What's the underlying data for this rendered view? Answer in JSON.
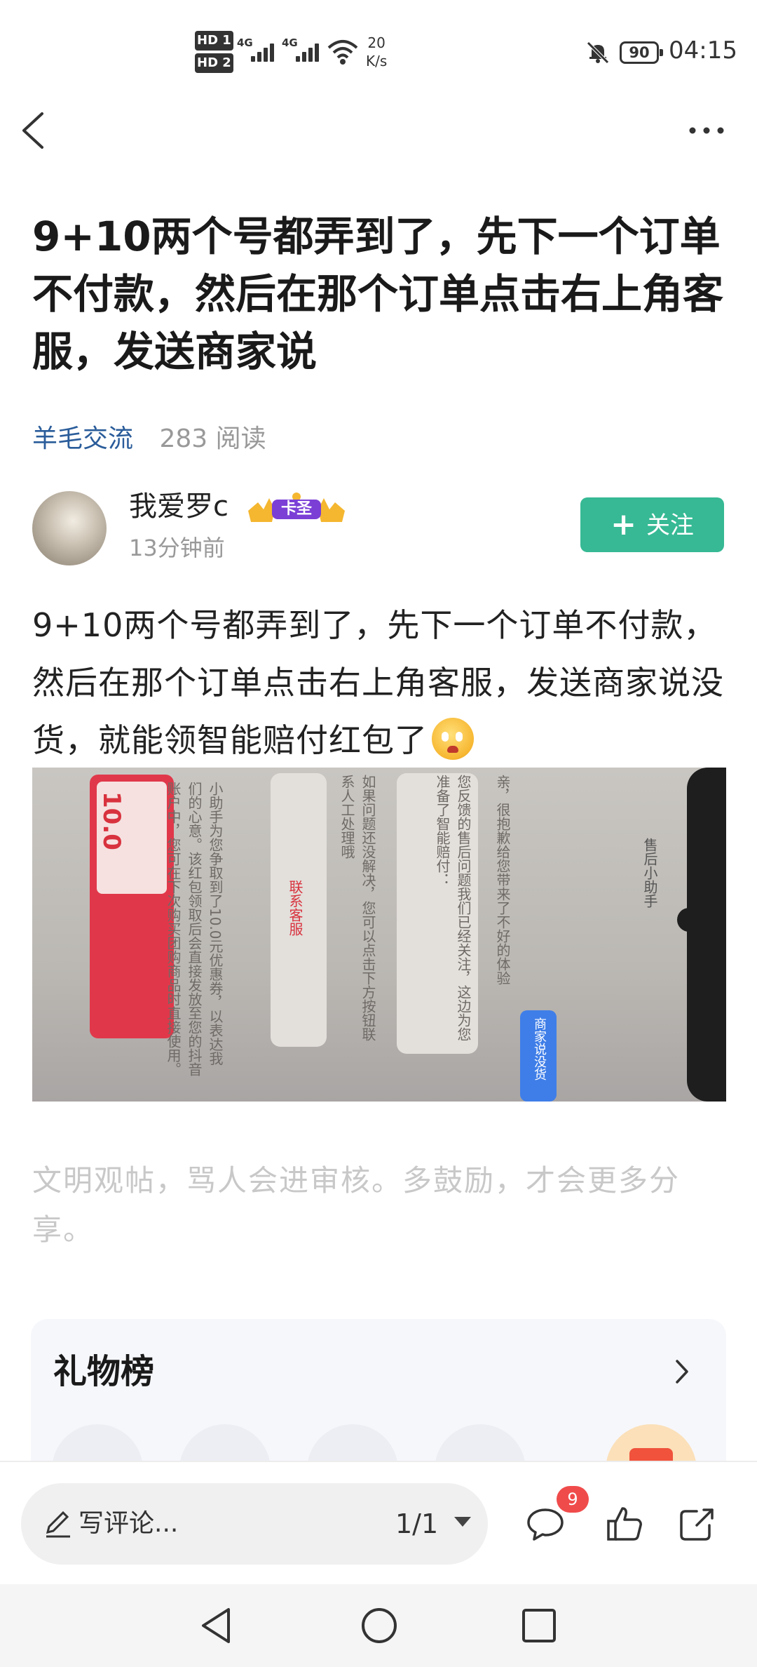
{
  "status_bar": {
    "hd1": "HD 1",
    "hd2": "HD 2",
    "net1": "4G",
    "net2": "4G",
    "speed_value": "20",
    "speed_unit": "K/s",
    "battery": "90",
    "time": "04:15"
  },
  "post": {
    "title": "9+10两个号都弄到了，先下一个订单不付款，然后在那个订单点击右上角客服，发送商家说",
    "category": "羊毛交流",
    "reads": "283 阅读",
    "author_name": "我爱罗c",
    "badge_label": "卡圣",
    "time_ago": "13分钟前",
    "follow_label": "关注",
    "body": "9+10两个号都弄到了，先下一个订单不付款，然后在那个订单点击右上角客服，发送商家说没货，就能领智能赔付红包了",
    "hint": "文明观帖，骂人会进审核。多鼓励，才会更多分享。"
  },
  "photo_text": {
    "coupon_amount": "10.0",
    "service_btn": "联系客服",
    "line1": "亲，很抱歉给您带来了不好的体验",
    "line2": "您反馈的售后问题我们已经关注，这边为您准备了智能赔付：",
    "line3": "如果问题还没解决，您可以点击下方按钮联系人工处理哦",
    "line4": "小助手为您争取到了10.0元优惠券，以表达我们的心意。该红包领取后会直接发放至您的抖音账户中，您可在下次购买团购商品时直接使用。",
    "blue_btn": "商家说没货",
    "assistant": "售后小助手"
  },
  "gift_board": {
    "title": "礼物榜"
  },
  "bottom_bar": {
    "comment_placeholder": "写评论...",
    "page_indicator": "1/1",
    "comment_count": "9"
  },
  "icons": {
    "back": "chevron-left-icon",
    "more": "more-dots-icon",
    "comment": "comment-bubble-icon",
    "like": "thumbs-up-icon",
    "share": "share-icon"
  },
  "colors": {
    "accent_green": "#36b994",
    "category_blue": "#2a5c9a",
    "badge_red": "#f04b4b"
  }
}
